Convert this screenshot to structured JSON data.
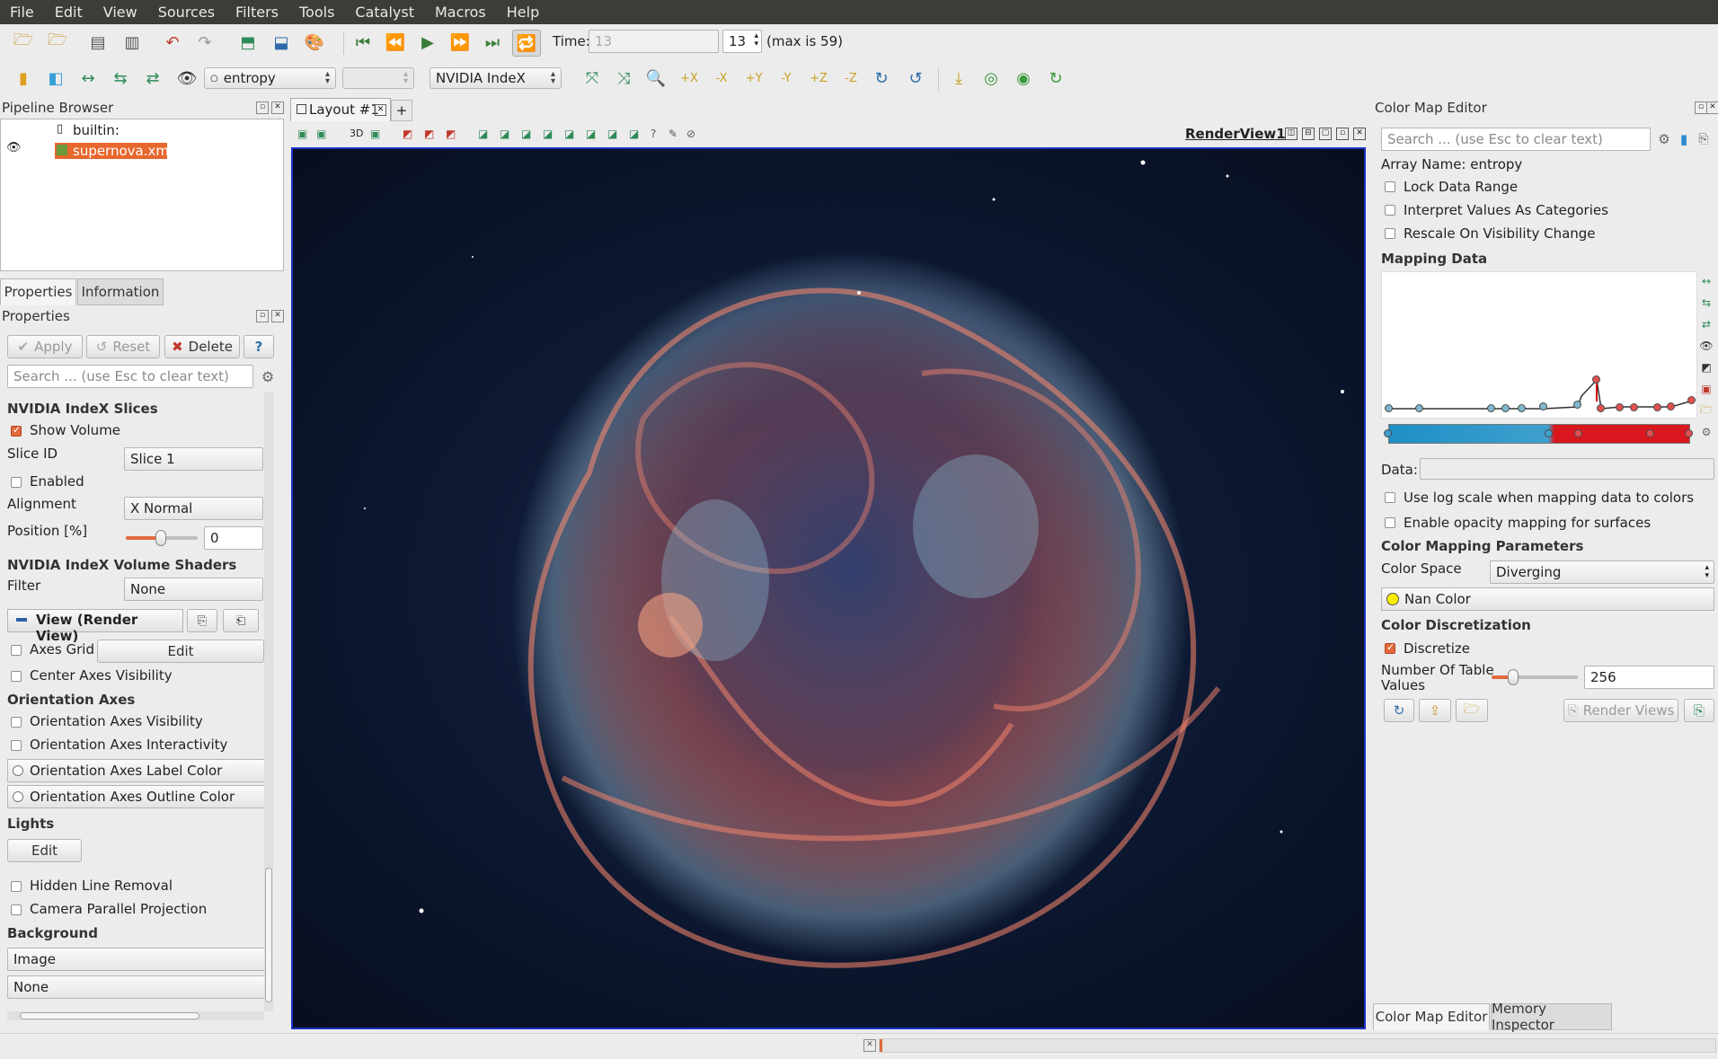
{
  "menu": [
    "File",
    "Edit",
    "View",
    "Sources",
    "Filters",
    "Tools",
    "Catalyst",
    "Macros",
    "Help"
  ],
  "toolbar1": {
    "time_label": "Time:",
    "time_value": "13",
    "timestep_value": "13",
    "max_label": "(max is 59)"
  },
  "toolbar2": {
    "array_combo": "entropy",
    "component_combo": "",
    "representation_combo": "NVIDIA IndeX"
  },
  "pipeline": {
    "title": "Pipeline Browser",
    "root": "builtin:",
    "item": "supernova.xmf"
  },
  "props": {
    "tabs": [
      "Properties",
      "Information"
    ],
    "title": "Properties",
    "apply": "Apply",
    "reset": "Reset",
    "delete": "Delete",
    "help": "?",
    "search_placeholder": "Search ... (use Esc to clear text)",
    "sec_slices": "NVIDIA IndeX Slices",
    "show_volume": "Show Volume",
    "slice_id_label": "Slice ID",
    "slice_id_value": "Slice 1",
    "enabled": "Enabled",
    "alignment_label": "Alignment",
    "alignment_value": "X Normal",
    "position_label": "Position [%]",
    "position_value": "0",
    "sec_shaders": "NVIDIA IndeX Volume Shaders",
    "filter_label": "Filter",
    "filter_value": "None",
    "view_header": "View (Render View)",
    "axes_grid": "Axes Grid",
    "axes_grid_edit": "Edit",
    "center_axes": "Center Axes Visibility",
    "sec_orient": "Orientation Axes",
    "orient_vis": "Orientation Axes Visibility",
    "orient_inter": "Orientation Axes Interactivity",
    "orient_label_color": "Orientation Axes Label Color",
    "orient_outline_color": "Orientation Axes Outline Color",
    "sec_lights": "Lights",
    "lights_edit": "Edit",
    "hidden_line": "Hidden Line Removal",
    "camera_parallel": "Camera Parallel Projection",
    "sec_background": "Background",
    "bg_value": "Image",
    "bg_image_value": "None"
  },
  "layout": {
    "tab": "Layout #1",
    "view_name": "RenderView1",
    "toolbar_3d": "3D"
  },
  "cme": {
    "title": "Color Map Editor",
    "search_placeholder": "Search ... (use Esc to clear text)",
    "array_name": "Array Name: entropy",
    "lock_range": "Lock Data Range",
    "interpret": "Interpret Values As Categories",
    "rescale_vis": "Rescale On Visibility Change",
    "sec_mapping": "Mapping Data",
    "data_label": "Data:",
    "log_scale": "Use log scale when mapping data to colors",
    "opacity_surfaces": "Enable opacity mapping for surfaces",
    "sec_params": "Color Mapping Parameters",
    "color_space_label": "Color Space",
    "color_space_value": "Diverging",
    "nan_color": "Nan Color",
    "sec_discretization": "Color Discretization",
    "discretize": "Discretize",
    "table_values_label_1": "Number Of Table",
    "table_values_label_2": "Values",
    "table_values": "256",
    "render_views": "Render Views",
    "bottom_tabs": [
      "Color Map Editor",
      "Memory Inspector"
    ],
    "colorbar": {
      "low": "#1e8fc4",
      "mid": "#3fa0cf",
      "high": "#d8181e"
    },
    "nan_swatch": "#ffee00"
  }
}
